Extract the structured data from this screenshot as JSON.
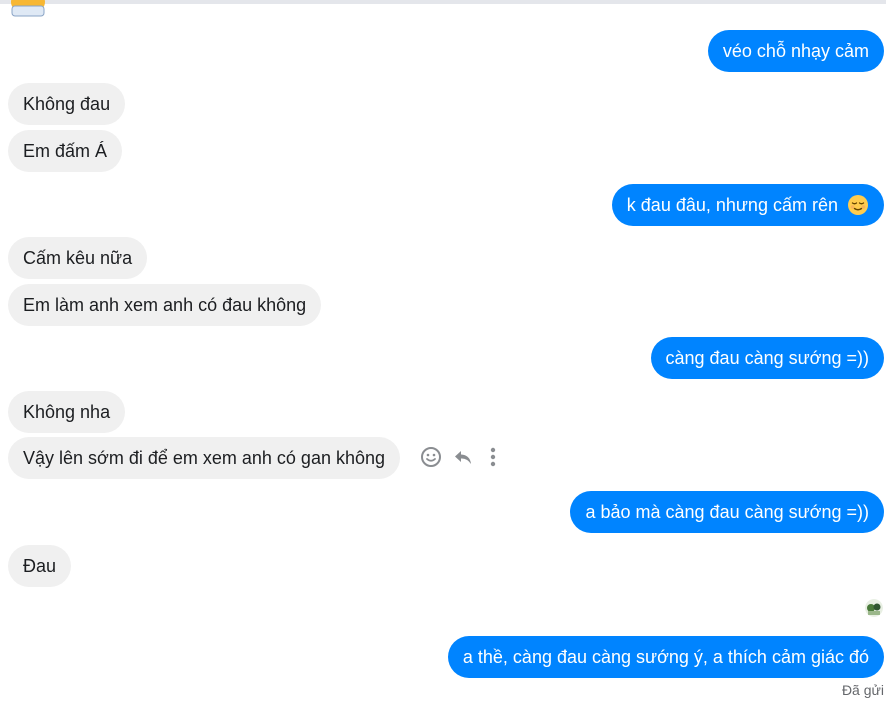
{
  "messages": [
    {
      "dir": "out",
      "text": "véo chỗ nhạy cảm"
    },
    {
      "dir": "in",
      "text": "Không đau"
    },
    {
      "dir": "in",
      "text": "Em đấm Á"
    },
    {
      "dir": "out",
      "text": "k đau đâu, nhưng cấm rên",
      "emoji": "relieved-face"
    },
    {
      "dir": "in",
      "text": "Cấm kêu nữa"
    },
    {
      "dir": "in",
      "text": "Em làm anh xem anh có đau không"
    },
    {
      "dir": "out",
      "text": "càng đau càng sướng =))"
    },
    {
      "dir": "in",
      "text": "Không nha"
    },
    {
      "dir": "in",
      "text": "Vậy lên sớm đi để em xem anh có gan không"
    },
    {
      "dir": "out",
      "text": "a bảo mà càng đau càng sướng =))"
    },
    {
      "dir": "in",
      "text": "Đau"
    },
    {
      "dir": "out",
      "text": "a thề, càng đau càng sướng ý, a thích cảm giác đó"
    }
  ],
  "message_actions": [
    "smiley-icon",
    "reply-icon",
    "more-icon"
  ],
  "status": "Đã gửi",
  "colors": {
    "outgoing": "#0084ff",
    "incoming": "#f0f0f0",
    "status": "#65676b"
  }
}
